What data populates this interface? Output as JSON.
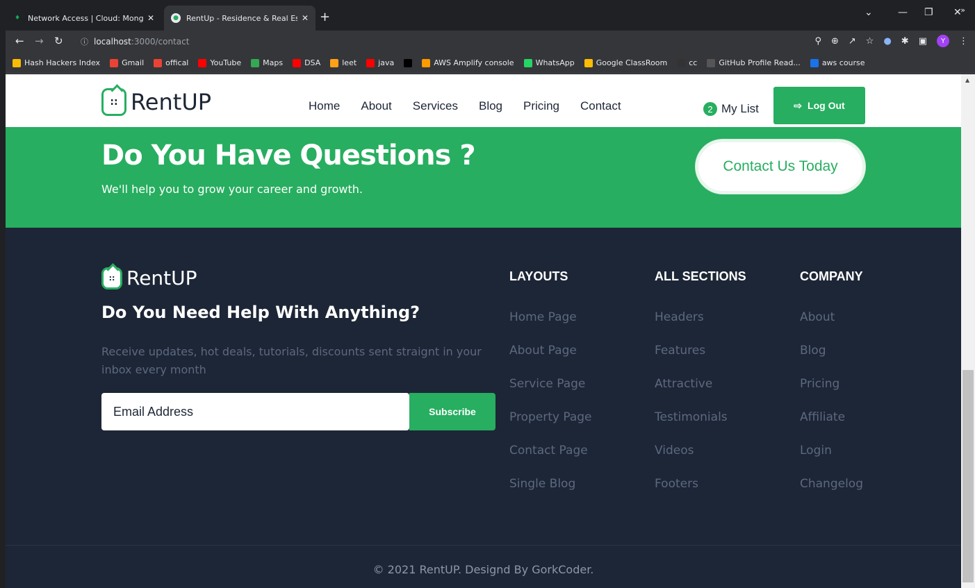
{
  "browser": {
    "tabs": [
      {
        "title": "Network Access | Cloud: MongoD",
        "active": false
      },
      {
        "title": "RentUp - Residence & Real Estate",
        "active": true
      }
    ],
    "url_host": "localhost",
    "url_path": ":3000/contact",
    "bookmarks": [
      {
        "label": "Hash Hackers Index",
        "color": "#fbbc04"
      },
      {
        "label": "Gmail",
        "color": "#ea4335"
      },
      {
        "label": "offical",
        "color": "#ea4335"
      },
      {
        "label": "YouTube",
        "color": "#ff0000"
      },
      {
        "label": "Maps",
        "color": "#34a853"
      },
      {
        "label": "DSA",
        "color": "#ff0000"
      },
      {
        "label": "leet",
        "color": "#ffa116"
      },
      {
        "label": "java",
        "color": "#ff0000"
      },
      {
        "label": "",
        "color": "#000000"
      },
      {
        "label": "AWS Amplify console",
        "color": "#f90"
      },
      {
        "label": "WhatsApp",
        "color": "#25d366"
      },
      {
        "label": "Google ClassRoom",
        "color": "#fbbc04"
      },
      {
        "label": "cc",
        "color": "#333333"
      },
      {
        "label": "GitHub Profile Read...",
        "color": "#555555"
      },
      {
        "label": "aws course",
        "color": "#1a73e8"
      }
    ],
    "more_bookmarks": "»",
    "avatar_letter": "Y"
  },
  "header": {
    "logo_text": "RentUP",
    "nav": [
      "Home",
      "About",
      "Services",
      "Blog",
      "Pricing",
      "Contact"
    ],
    "mylist_count": "2",
    "mylist_label": "My List",
    "logout_label": "Log Out"
  },
  "banner": {
    "title": "Do You Have Questions ?",
    "subtitle": "We'll help you to grow your career and growth.",
    "cta": "Contact Us Today"
  },
  "footer": {
    "logo_text": "RentUP",
    "title": "Do You Need Help With Anything?",
    "description": "Receive updates, hot deals, tutorials, discounts sent straignt in your inbox every month",
    "email_placeholder": "Email Address",
    "subscribe_label": "Subscribe",
    "columns": [
      {
        "title": "LAYOUTS",
        "links": [
          "Home Page",
          "About Page",
          "Service Page",
          "Property Page",
          "Contact Page",
          "Single Blog"
        ]
      },
      {
        "title": "ALL SECTIONS",
        "links": [
          "Headers",
          "Features",
          "Attractive",
          "Testimonials",
          "Videos",
          "Footers"
        ]
      },
      {
        "title": "COMPANY",
        "links": [
          "About",
          "Blog",
          "Pricing",
          "Affiliate",
          "Login",
          "Changelog"
        ]
      }
    ],
    "copyright": "© 2021 RentUP. Designd By GorkCoder."
  },
  "colors": {
    "brand": "#27ae60",
    "footer_bg": "#1d2636"
  }
}
